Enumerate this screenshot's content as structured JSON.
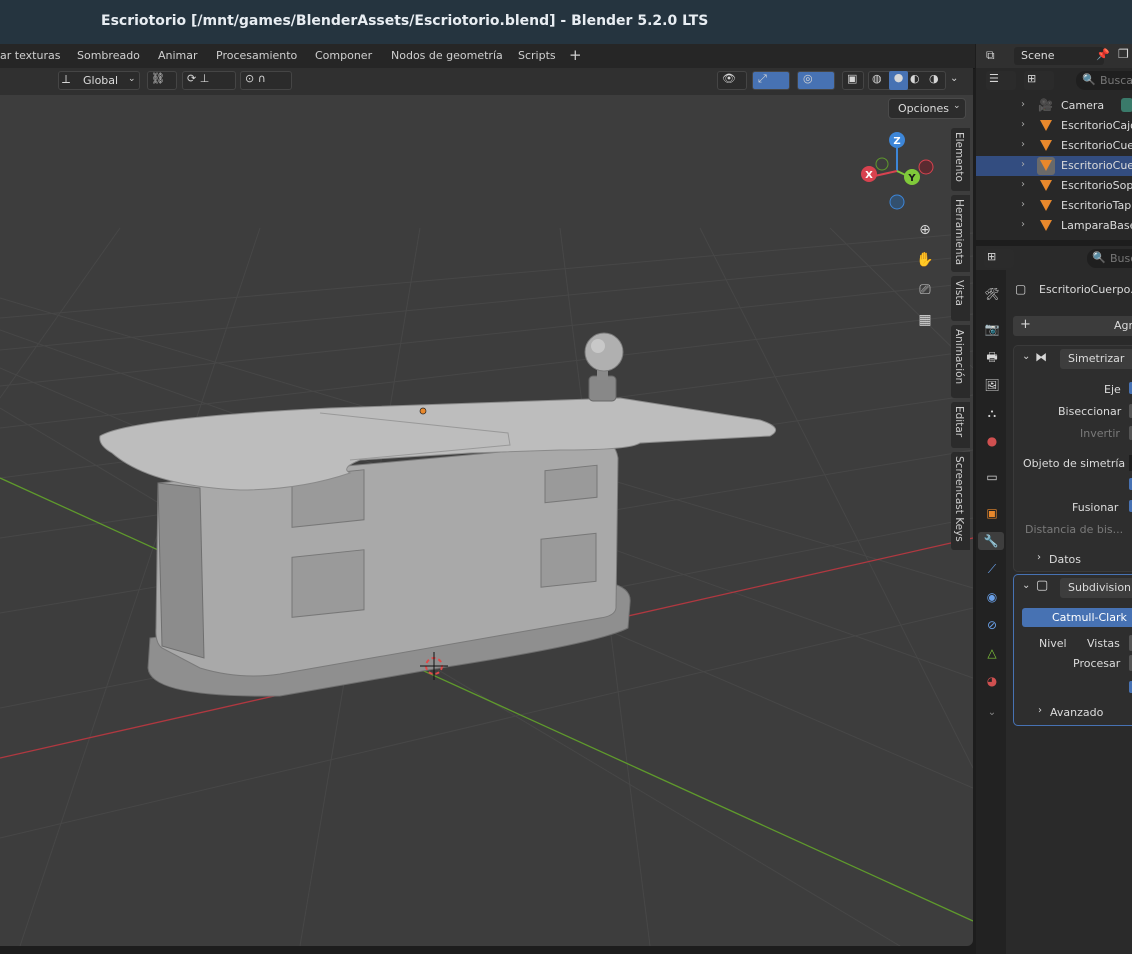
{
  "window": {
    "title": "Escriotorio [/mnt/games/BlenderAssets/Escriotorio.blend] - Blender 5.2.0 LTS"
  },
  "workspace_tabs": [
    "ar texturas",
    "Sombreado",
    "Animar",
    "Procesamiento",
    "Componer",
    "Nodos de geometría",
    "Scripts"
  ],
  "add_tab_label": "+",
  "viewport_header": {
    "transform_orientation": "Global"
  },
  "viewport": {
    "options_label": "Opciones"
  },
  "sidebar_tabs": [
    "Elemento",
    "Herramienta",
    "Vista",
    "Animación",
    "Editar",
    "Screencast Keys"
  ],
  "gizmo": {
    "x": "X",
    "y": "Y",
    "z": "Z"
  },
  "outliner": {
    "scene_label": "Scene",
    "search_placeholder": "Busca",
    "items": [
      "Camera",
      "EscritorioCajo",
      "EscritorioCue",
      "EscritorioCue",
      "EscritorioSop",
      "EscritorioTap",
      "LamparaBase"
    ]
  },
  "properties": {
    "search_placeholder": "Busc",
    "object_name": "EscritorioCuerpo.",
    "add_modifier_label": "Agr",
    "mirror": {
      "name": "Simetrizar",
      "eje": "Eje",
      "biseccionar": "Biseccionar",
      "invertir": "Invertir",
      "objeto": "Objeto de simetría",
      "fusionar": "Fusionar",
      "distancia": "Distancia de bis...",
      "datos": "Datos"
    },
    "subsurf": {
      "name": "Subdivision",
      "method": "Catmull-Clark",
      "nivel": "Nivel",
      "vistas": "Vistas",
      "procesar": "Procesar",
      "avanzado": "Avanzado"
    }
  },
  "colors": {
    "accent": "#4772b3",
    "object_orange": "#e8882c",
    "x_axis": "#d8424f",
    "y_axis": "#80c93a",
    "z_axis": "#3d86d8"
  }
}
